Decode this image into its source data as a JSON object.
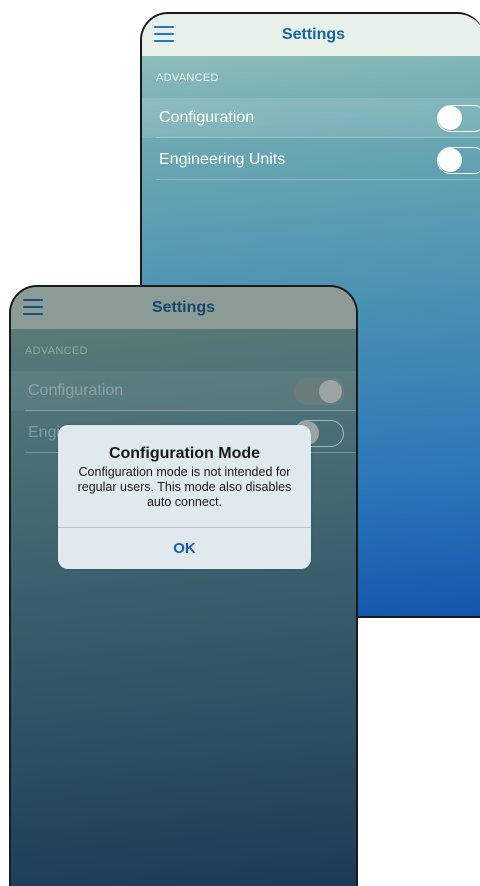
{
  "back_screen": {
    "header": {
      "title": "Settings",
      "menu_icon": "hamburger-icon"
    },
    "section_label": "ADVANCED",
    "rows": [
      {
        "label": "Configuration",
        "toggle": "off"
      },
      {
        "label": "Engineering Units",
        "toggle": "off"
      }
    ]
  },
  "front_screen": {
    "header": {
      "title": "Settings",
      "menu_icon": "hamburger-icon"
    },
    "section_label": "ADVANCED",
    "rows": [
      {
        "label": "Configuration",
        "toggle": "on"
      },
      {
        "label": "Engi",
        "toggle": "off"
      }
    ]
  },
  "alert": {
    "title": "Configuration Mode",
    "message": "Configuration mode is not intended for regular users. This mode also disables auto connect.",
    "ok_label": "OK"
  },
  "colors": {
    "accent": "#1566a8",
    "back_gradient_top": "#9cc7bd",
    "back_gradient_bottom": "#1457ad",
    "front_gradient_top": "#5e7f77",
    "front_gradient_bottom": "#1c3a58"
  }
}
